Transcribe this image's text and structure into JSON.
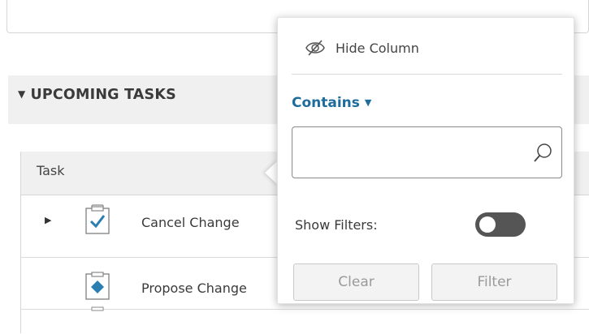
{
  "section": {
    "title": "UPCOMING TASKS"
  },
  "table": {
    "column_task": "Task",
    "rows": [
      {
        "label": "Cancel Change",
        "icon": "task-check-icon",
        "expandable": true
      },
      {
        "label": "Propose Change",
        "icon": "task-diamond-icon",
        "expandable": false
      }
    ]
  },
  "popup": {
    "hide_column_label": "Hide Column",
    "filter_mode": "Contains",
    "search_value": "",
    "show_filters_label": "Show Filters:",
    "show_filters_on": false,
    "clear_label": "Clear",
    "filter_label": "Filter"
  },
  "colors": {
    "accent_blue": "#1d6c9c",
    "header_bg": "#f0f0f0",
    "toggle_off": "#555555"
  }
}
